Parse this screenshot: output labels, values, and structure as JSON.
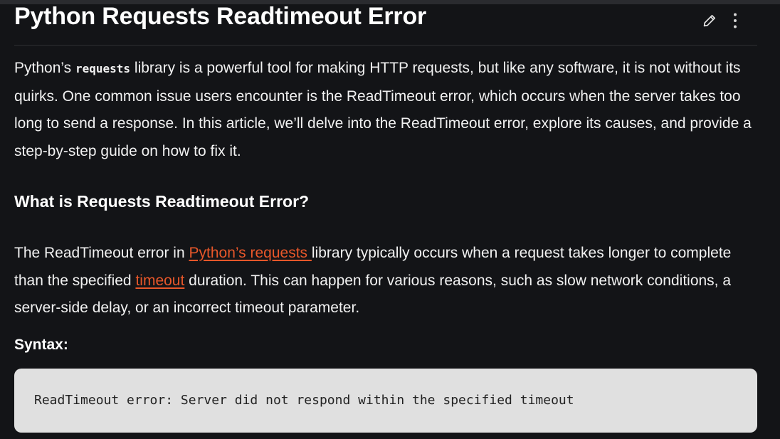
{
  "article": {
    "title": "Python Requests Readtimeout Error",
    "actions": {
      "edit_icon": "pencil-icon",
      "more_icon": "vertical-ellipsis-icon"
    },
    "intro": {
      "before_code": "Python’s ",
      "code": "requests",
      "after_code": " library is a powerful tool for making HTTP requests, but like any software, it is not without its quirks. One common issue users encounter is the ReadTimeout error, which occurs when the server takes too long to send a response. In this article, we’ll delve into the ReadTimeout error, explore its causes, and provide a step-by-step guide on how to fix it."
    },
    "section_heading": "What is Requests Readtimeout Error?",
    "body": {
      "part1": "The ReadTimeout error in ",
      "link1": "Python’s requests ",
      "part2": "library typically occurs when a request takes longer to complete than the specified ",
      "link2": "timeout",
      "part3": " duration. This can happen for various reasons, such as slow network conditions, a server-side delay, or an incorrect timeout parameter."
    },
    "syntax_label": "Syntax:",
    "code_block": "ReadTimeout error: Server did not respond within the specified timeout"
  },
  "colors": {
    "background": "#131417",
    "text": "#f1f1f1",
    "link": "#e8572a",
    "code_background": "#e0e0e0"
  }
}
